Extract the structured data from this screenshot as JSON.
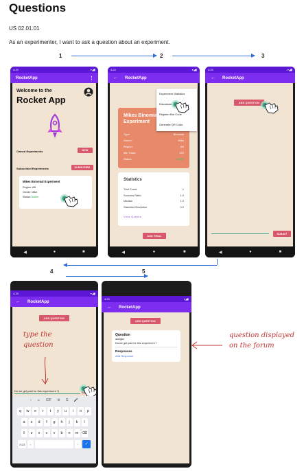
{
  "doc": {
    "title": "Questions",
    "story_id": "US 02.01.01",
    "story": "As an experimenter, I want to ask a question about an experiment.",
    "steps": [
      "1",
      "2",
      "3",
      "4",
      "5"
    ]
  },
  "status": {
    "time": "4:23",
    "icons": "▾◢▮"
  },
  "nav": {
    "back": "◀",
    "home": "●",
    "recent": "■"
  },
  "screen1": {
    "app_title": "RocketApp",
    "menu_icon": "⋮",
    "welcome": "Welcome to the",
    "app_name": "Rocket App",
    "owned_label": "Owned Experiments",
    "new_button": "NEW",
    "subscribed_label": "Subscribed Experiments",
    "subscribe_button": "SUBSCRIBE",
    "card": {
      "title": "Mikes Binomial Experiment",
      "region": "Region: AB",
      "owner": "Owner: Mike",
      "status_label": "Status:",
      "status_value": "Active"
    }
  },
  "screen2": {
    "app_title": "RocketApp",
    "menu_items": [
      "Experiment Statistics",
      "Discussion",
      "Register Bar Code",
      "Generate QR Code"
    ],
    "exp_title": "Mikes Binomial Experiment",
    "fields": [
      {
        "label": "Type:",
        "value": "Binomial"
      },
      {
        "label": "Owner:",
        "value": "Mike"
      },
      {
        "label": "Region:",
        "value": "AB"
      },
      {
        "label": "Min Trials:",
        "value": "120"
      },
      {
        "label": "Status:",
        "value": "Active"
      }
    ],
    "stats_title": "Statistics",
    "stats": [
      {
        "label": "Trial Count",
        "value": "1"
      },
      {
        "label": "Success Ratio",
        "value": "1.0"
      },
      {
        "label": "Median",
        "value": "1.0"
      },
      {
        "label": "Standard Deviation",
        "value": "0.0"
      }
    ],
    "view_graphs": "View Graphs",
    "add_trial": "ADD TRIAL"
  },
  "screen3": {
    "app_title": "RocketApp",
    "add_question": "ADD QUESTION",
    "submit": "SUBMIT"
  },
  "screen4": {
    "app_title": "RocketApp",
    "add_question": "ADD QUESTION",
    "input_value": "Do we get paid for this experiment ?|",
    "keyboard_rows": [
      [
        "q",
        "w",
        "e",
        "r",
        "t",
        "y",
        "u",
        "i",
        "o",
        "p"
      ],
      [
        "a",
        "s",
        "d",
        "f",
        "g",
        "h",
        "j",
        "k",
        "l"
      ],
      [
        "z",
        "x",
        "c",
        "v",
        "b",
        "n",
        "m"
      ]
    ],
    "kb_toolbar": [
      "‹",
      "☺",
      "GIF",
      "⚙",
      "G",
      "🎤"
    ],
    "kb_bottom": {
      "left": "?123",
      "comma": ",",
      "enter": "✓"
    }
  },
  "screen5": {
    "app_title": "RocketApp",
    "add_question": "ADD QUESTION",
    "question_heading": "Question",
    "author": "asingh2",
    "question_text": "Do we get paid for this experiment ?",
    "responses_heading": "Responses",
    "add_response": "Add Response"
  },
  "annotations": {
    "type_question": "type the question",
    "displayed": "question displayed on the forum"
  },
  "colors": {
    "appbar": "#7c2df0",
    "accent": "#d9576a",
    "screen_bg": "#f2e4d2",
    "arrow": "#2f6fd6",
    "annotation": "#c23434"
  }
}
